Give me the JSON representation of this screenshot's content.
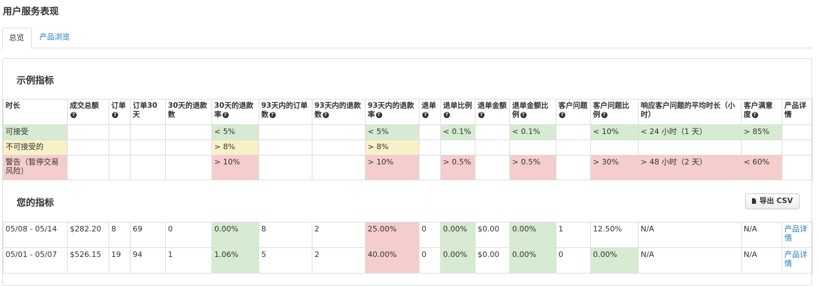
{
  "page": {
    "title": "用户服务表现"
  },
  "tabs": [
    {
      "label": "总览",
      "active": true
    },
    {
      "label": "产品浏览",
      "active": false
    }
  ],
  "example": {
    "title": "示例指标",
    "headers": [
      "时长",
      "成交总额",
      "订单",
      "订单30天",
      "30天的退款数",
      "30天的退款率",
      "93天内的订单数",
      "93天内的退款数",
      "93天内的退款率",
      "退单",
      "退单比例",
      "退单金额",
      "退单金额比例",
      "客户问题",
      "客户问题比例",
      "响应客户问题的平均时长（小时）",
      "客户满意度",
      "产品详情"
    ],
    "rows": [
      {
        "label": "可接受",
        "refund30": "< 5%",
        "refund93": "< 5%",
        "chargeback_ratio": "< 0.1%",
        "chargeback_amount_ratio": "< 0.1%",
        "issue_ratio": "< 10%",
        "response": "< 24 小时（1 天）",
        "satisfaction": "> 85%"
      },
      {
        "label": "不可接受的",
        "refund30": "> 8%",
        "refund93": "> 8%"
      },
      {
        "label": "警告（暂停交易风险）",
        "refund30": "> 10%",
        "refund93": "> 10%",
        "chargeback_ratio": "> 0.5%",
        "chargeback_amount_ratio": "> 0.5%",
        "issue_ratio": "> 30%",
        "response": "> 48 小时（2 天）",
        "satisfaction": "< 60%"
      }
    ]
  },
  "mine": {
    "title": "您的指标",
    "export_label": "导出 CSV",
    "rows": [
      {
        "period": "05/08 - 05/14",
        "gmv": "$282.20",
        "orders": "8",
        "orders30": "69",
        "refunds30": "0",
        "refund_rate30": "0.00%",
        "orders93": "8",
        "refunds93": "2",
        "refund_rate93": "25.00%",
        "chargebacks": "0",
        "chargeback_ratio": "0.00%",
        "chargeback_amount": "$0.00",
        "chargeback_amount_ratio": "0.00%",
        "issues": "1",
        "issue_ratio": "12.50%",
        "response": "N/A",
        "satisfaction": "N/A",
        "details": "产品详情"
      },
      {
        "period": "05/01 - 05/07",
        "gmv": "$526.15",
        "orders": "19",
        "orders30": "94",
        "refunds30": "1",
        "refund_rate30": "1.06%",
        "orders93": "5",
        "refunds93": "2",
        "refund_rate93": "40.00%",
        "chargebacks": "0",
        "chargeback_ratio": "0.00%",
        "chargeback_amount": "$0.00",
        "chargeback_amount_ratio": "0.00%",
        "issues": "0",
        "issue_ratio": "0.00%",
        "response": "N/A",
        "satisfaction": "N/A",
        "details": "产品详情"
      }
    ]
  },
  "icons": {
    "help": "question-circle-icon",
    "export": "file-icon"
  },
  "colors": {
    "green": "#d6ebd1",
    "yellow": "#f8f1c8",
    "red": "#f5cdcc",
    "link": "#1a7ab8"
  }
}
